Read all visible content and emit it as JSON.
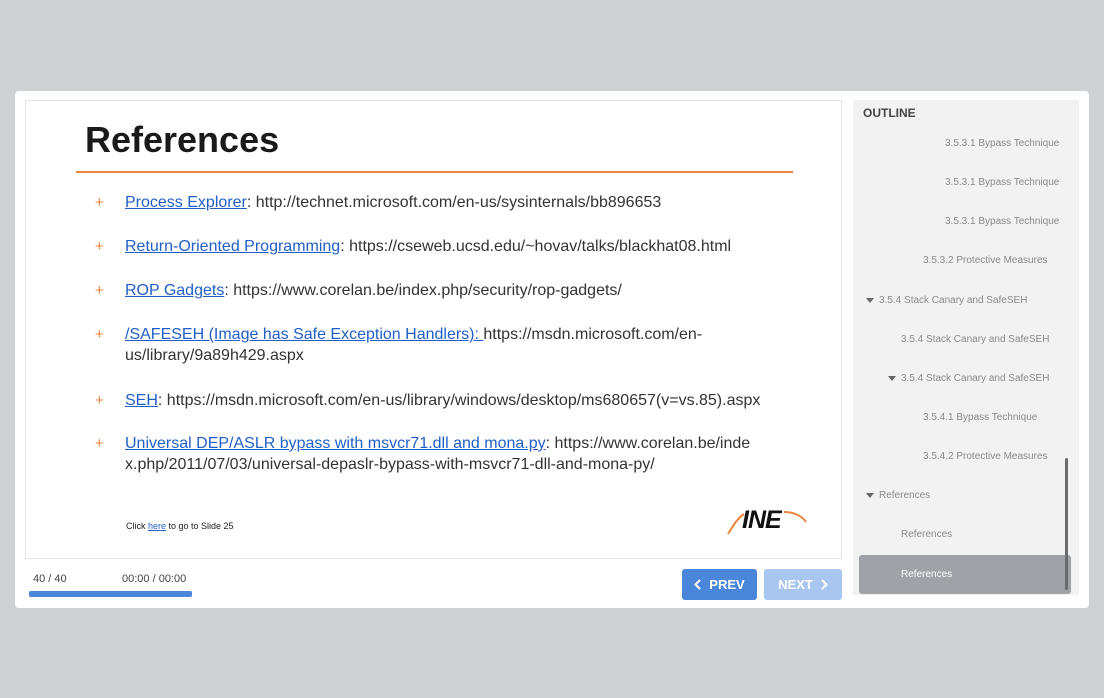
{
  "slide": {
    "title": "References",
    "refs": [
      {
        "link": "Process Explorer",
        "text": ": http://technet.microsoft.com/en-us/sysinternals/bb896653"
      },
      {
        "link": "Return-Oriented Programming",
        "text": ": https://cseweb.ucsd.edu/~hovav/talks/blackhat08.html"
      },
      {
        "link": "ROP Gadgets",
        "text": ": https://www.corelan.be/index.php/security/rop-gadgets/"
      },
      {
        "link": "/SAFESEH (Image has Safe Exception Handlers): ",
        "text": "https://msdn.microsoft.com/en-us/library/9a89h429.aspx"
      },
      {
        "link": "SEH",
        "text": ": https://msdn.microsoft.com/en-us/library/windows/desktop/ms680657(v=vs.85).aspx"
      },
      {
        "link": "Universal DEP/ASLR bypass with msvcr71.dll and mona.py",
        "text": ": https://www.corelan.be/index.php/2011/07/03/universal-depaslr-bypass-with-msvcr71-dll-and-mona-py/"
      }
    ],
    "bullet": "+",
    "click_prefix": "Click ",
    "click_link": "here",
    "click_suffix": " to go to Slide 25",
    "logo_text": "INE"
  },
  "player": {
    "counter": "40 / 40",
    "time": "00:00 / 00:00",
    "progress": 1.0,
    "prev_label": "PREV",
    "next_label": "NEXT",
    "accent": "#4a86d9"
  },
  "outline": {
    "heading": "OUTLINE",
    "items": [
      {
        "label": "3.5.3.1 Bypass Technique",
        "expanded": false
      },
      {
        "label": "3.5.3.1 Bypass Technique",
        "expanded": false
      },
      {
        "label": "3.5.3.1 Bypass Technique",
        "expanded": false
      },
      {
        "label": "3.5.3.2 Protective Measures",
        "expanded": false
      },
      {
        "label": "3.5.4 Stack Canary and SafeSEH",
        "expanded": true
      },
      {
        "label": "3.5.4 Stack Canary and SafeSEH",
        "expanded": false
      },
      {
        "label": "3.5.4 Stack Canary and SafeSEH",
        "expanded": true
      },
      {
        "label": "3.5.4.1 Bypass Technique",
        "expanded": false
      },
      {
        "label": "3.5.4.2 Protective Measures",
        "expanded": false
      },
      {
        "label": "References",
        "expanded": true
      },
      {
        "label": "References",
        "expanded": false
      }
    ],
    "selected": "References"
  }
}
